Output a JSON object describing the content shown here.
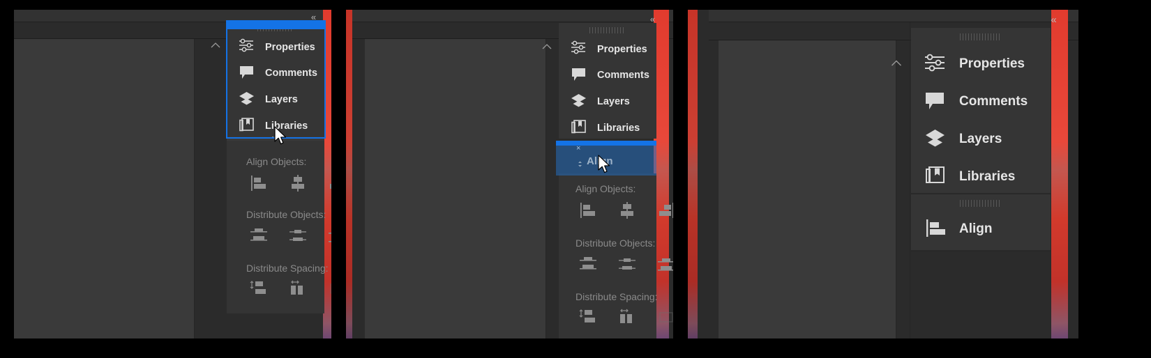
{
  "app": {
    "background_color": "#2b2b2b",
    "accent_color": "#1473e6",
    "panel_color": "#353535",
    "text_color": "#e6e6e6",
    "muted_text_color": "#8a8a8a"
  },
  "collapse_control": {
    "label": "«",
    "name": "collapse-dock"
  },
  "panels": [
    {
      "id": "properties",
      "label": "Properties",
      "icon": "sliders-icon"
    },
    {
      "id": "comments",
      "label": "Comments",
      "icon": "comment-bubble-icon"
    },
    {
      "id": "layers",
      "label": "Layers",
      "icon": "layers-stack-icon"
    },
    {
      "id": "libraries",
      "label": "Libraries",
      "icon": "libraries-book-icon"
    },
    {
      "id": "align",
      "label": "Align",
      "icon": "align-left-icon"
    }
  ],
  "align_panel": {
    "tab_label": "Align",
    "close_label": "×",
    "menu_glyph": "≡",
    "sections": [
      {
        "title": "Align Objects:",
        "buttons": [
          {
            "name": "align-left-edges-button",
            "icon": "align-left-edges-icon"
          },
          {
            "name": "align-horizontal-centers-button",
            "icon": "align-horizontal-centers-icon"
          },
          {
            "name": "align-right-edges-button",
            "icon": "align-right-edges-icon"
          }
        ]
      },
      {
        "title": "Distribute Objects:",
        "buttons": [
          {
            "name": "distribute-top-edges-button",
            "icon": "distribute-top-edges-icon"
          },
          {
            "name": "distribute-vertical-centers-button",
            "icon": "distribute-vertical-centers-icon"
          },
          {
            "name": "distribute-bottom-edges-button",
            "icon": "distribute-bottom-edges-icon"
          }
        ]
      },
      {
        "title": "Distribute Spacing:",
        "buttons": [
          {
            "name": "distribute-vertical-space-button",
            "icon": "distribute-vertical-space-icon"
          },
          {
            "name": "distribute-horizontal-space-button",
            "icon": "distribute-horizontal-space-icon"
          },
          {
            "name": "use-spacing-button",
            "icon": "use-spacing-icon"
          }
        ]
      }
    ]
  },
  "frames": [
    {
      "id": "frame-1",
      "caption_state": "align-panel-dragged-over-panel-group",
      "panel_group_tabs": [
        "Properties",
        "Comments",
        "Layers",
        "Libraries"
      ],
      "dragged_panel": "Align",
      "selection_highlight": true,
      "drop_highlight": false,
      "cursor_visible": true
    },
    {
      "id": "frame-2",
      "caption_state": "align-panel-drop-target-highlighted",
      "panel_group_tabs": [
        "Properties",
        "Comments",
        "Layers",
        "Libraries"
      ],
      "dragged_panel": "Align",
      "selection_highlight": false,
      "drop_highlight": true,
      "cursor_visible": true
    },
    {
      "id": "frame-3",
      "caption_state": "align-panel-docked-as-new-group",
      "panel_group_tabs": [
        "Properties",
        "Comments",
        "Layers",
        "Libraries"
      ],
      "docked_group_tabs": [
        "Align"
      ],
      "selection_highlight": false,
      "drop_highlight": false,
      "cursor_visible": false
    }
  ]
}
